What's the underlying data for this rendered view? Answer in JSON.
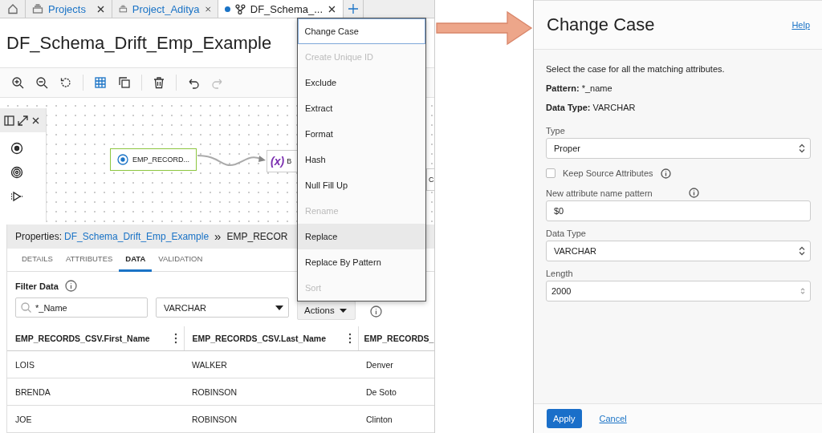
{
  "tabs": [
    {
      "kind": "home",
      "selected": false,
      "modified": false
    },
    {
      "kind": "project",
      "label": "Projects",
      "selected": false,
      "modified": false
    },
    {
      "kind": "project",
      "label": "Project_Aditya",
      "selected": false,
      "modified": false
    },
    {
      "kind": "flow",
      "label": "DF_Schema_...",
      "selected": true,
      "modified": true
    }
  ],
  "title": "DF_Schema_Drift_Emp_Example",
  "toolbar": [
    [
      {
        "kind": "zoom-in",
        "on": false,
        "disabled": false
      },
      {
        "kind": "zoom-out",
        "on": false,
        "disabled": false
      },
      {
        "kind": "reset",
        "on": false,
        "disabled": false
      }
    ],
    [
      {
        "kind": "grid",
        "on": true,
        "disabled": false
      },
      {
        "kind": "copy",
        "on": false,
        "disabled": false
      }
    ],
    [
      {
        "kind": "delete",
        "on": false,
        "disabled": false
      }
    ],
    [
      {
        "kind": "undo",
        "on": false,
        "disabled": false
      },
      {
        "kind": "redo",
        "on": false,
        "disabled": true
      }
    ]
  ],
  "canvas": {
    "palette": [
      {
        "kind": "source"
      },
      {
        "kind": "target"
      },
      {
        "kind": "filter"
      }
    ],
    "nodes": [
      {
        "kind": "source",
        "label": "EMP_RECORD...",
        "selected": true
      },
      {
        "kind": "expression",
        "symbol": "(x)",
        "label": "B",
        "selected": false
      },
      {
        "kind": "other",
        "label": "C",
        "selected": false
      }
    ]
  },
  "properties": {
    "label": "Properties:",
    "flow_link": "DF_Schema_Drift_Emp_Example",
    "separator": "»",
    "node": "EMP_RECOR",
    "tabs": [
      {
        "label": "DETAILS",
        "selected": false
      },
      {
        "label": "ATTRIBUTES",
        "selected": false
      },
      {
        "label": "DATA",
        "selected": true
      },
      {
        "label": "VALIDATION",
        "selected": false
      }
    ],
    "filter": {
      "label": "Filter Data",
      "search": "*_Name",
      "data_type": "VARCHAR",
      "actions": "Actions"
    },
    "table": {
      "columns": [
        "EMP_RECORDS_CSV.First_Name",
        "EMP_RECORDS_CSV.Last_Name",
        "EMP_RECORDS_"
      ],
      "rows": [
        [
          "LOIS",
          "WALKER",
          "Denver"
        ],
        [
          "BRENDA",
          "ROBINSON",
          "De Soto"
        ],
        [
          "JOE",
          "ROBINSON",
          "Clinton"
        ]
      ]
    }
  },
  "menu": {
    "items": [
      {
        "label": "Change Case",
        "disabled": false,
        "focused": true,
        "hovered": false
      },
      {
        "label": "Create Unique ID",
        "disabled": true,
        "focused": false,
        "hovered": false
      },
      {
        "label": "Exclude",
        "disabled": false,
        "focused": false,
        "hovered": false
      },
      {
        "label": "Extract",
        "disabled": false,
        "focused": false,
        "hovered": false
      },
      {
        "label": "Format",
        "disabled": false,
        "focused": false,
        "hovered": false
      },
      {
        "label": "Hash",
        "disabled": false,
        "focused": false,
        "hovered": false
      },
      {
        "label": "Null Fill Up",
        "disabled": false,
        "focused": false,
        "hovered": false
      },
      {
        "label": "Rename",
        "disabled": true,
        "focused": false,
        "hovered": false
      },
      {
        "label": "Replace",
        "disabled": false,
        "focused": false,
        "hovered": true
      },
      {
        "label": "Replace By Pattern",
        "disabled": false,
        "focused": false,
        "hovered": false
      },
      {
        "label": "Sort",
        "disabled": true,
        "focused": false,
        "hovered": false
      }
    ]
  },
  "dialog": {
    "title": "Change Case",
    "help": "Help",
    "description": "Select the case for all the matching attributes.",
    "pattern": {
      "label": "Pattern:",
      "value": "*_name"
    },
    "data_type": {
      "label": "Data Type:",
      "value": "VARCHAR"
    },
    "type": {
      "label": "Type",
      "value": "Proper"
    },
    "keep_source": {
      "label": "Keep Source Attributes",
      "checked": false
    },
    "name_pattern": {
      "label": "New attribute name pattern",
      "value": "$0"
    },
    "new_data_type": {
      "label": "Data Type",
      "value": "VARCHAR"
    },
    "length": {
      "label": "Length",
      "value": "2000"
    },
    "apply": "Apply",
    "cancel": "Cancel"
  }
}
